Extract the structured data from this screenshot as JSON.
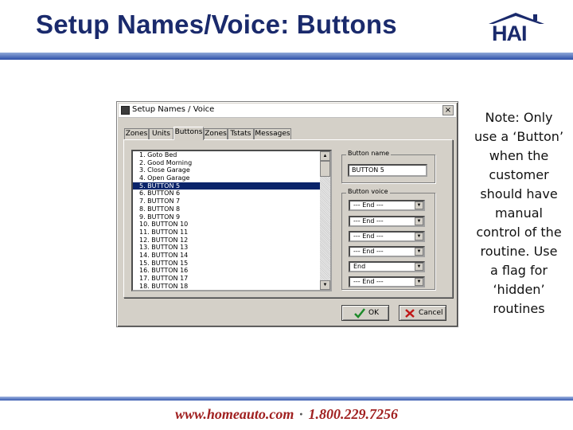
{
  "slide": {
    "title": "Setup Names/Voice: Buttons",
    "logo_text": "HAI",
    "footer_url": "www.homeauto.com",
    "footer_separator": "·",
    "footer_phone": "1.800.229.7256",
    "note_lines": [
      "Note: Only",
      "use a ‘Button’",
      "when the",
      "customer",
      "should have",
      "manual",
      "control of the",
      "routine.  Use",
      "a flag for",
      "‘hidden’",
      "routines"
    ]
  },
  "dialog": {
    "title": "Setup Names / Voice",
    "close_glyph": "×",
    "tabs": [
      {
        "label": "Zones"
      },
      {
        "label": "Units"
      },
      {
        "label": "Buttons"
      },
      {
        "label": "Zones"
      },
      {
        "label": "Tstats"
      },
      {
        "label": "Messages"
      }
    ],
    "active_tab": "Buttons",
    "button_list": [
      "1. Goto Bed",
      "2. Good Morning",
      "3. Close Garage",
      "4. Open Garage",
      "5. BUTTON 5",
      "6. BUTTON 6",
      "7. BUTTON 7",
      "8. BUTTON 8",
      "9. BUTTON 9",
      "10. BUTTON 10",
      "11. BUTTON 11",
      "12. BUTTON 12",
      "13. BUTTON 13",
      "14. BUTTON 14",
      "15. BUTTON 15",
      "16. BUTTON 16",
      "17. BUTTON 17",
      "18. BUTTON 18"
    ],
    "selected_index": 4,
    "button_name": {
      "label": "Button name",
      "value": "BUTTON 5"
    },
    "button_voice": {
      "label": "Button voice",
      "slots": [
        "--- End ---",
        "--- End ---",
        "--- End ---",
        "--- End ---",
        "End",
        "--- End ---"
      ]
    },
    "ok_label": "OK",
    "cancel_label": "Cancel",
    "colors": {
      "selection": "#0a246a",
      "title_navy": "#1a2a6c",
      "footer_red": "#a02020"
    }
  }
}
